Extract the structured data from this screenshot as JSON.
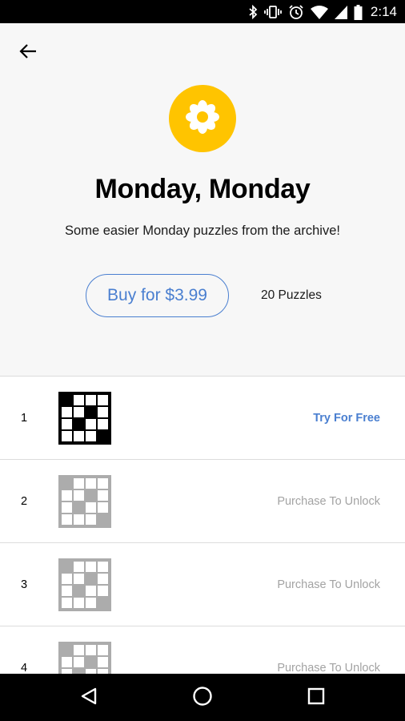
{
  "status_bar": {
    "time": "2:14",
    "icons": [
      "bluetooth-icon",
      "vibrate-icon",
      "alarm-icon",
      "wifi-icon",
      "signal-icon",
      "battery-icon"
    ]
  },
  "header": {
    "back_icon": "arrow-left-icon",
    "pack_icon": "flower-icon",
    "pack_icon_color": "#ffc400",
    "title": "Monday, Monday",
    "subtitle": "Some easier Monday puzzles from the archive!",
    "buy_label": "Buy for $3.99",
    "puzzle_count": "20 Puzzles"
  },
  "accent_color": "#4a7fd0",
  "puzzles": [
    {
      "number": "1",
      "action": "Try For Free",
      "locked": false
    },
    {
      "number": "2",
      "action": "Purchase To Unlock",
      "locked": true
    },
    {
      "number": "3",
      "action": "Purchase To Unlock",
      "locked": true
    },
    {
      "number": "4",
      "action": "Purchase To Unlock",
      "locked": true
    }
  ],
  "nav_bar": {
    "icons": [
      "back-triangle-icon",
      "home-circle-icon",
      "recents-square-icon"
    ]
  }
}
